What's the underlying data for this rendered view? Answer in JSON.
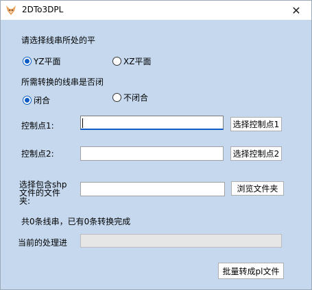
{
  "window": {
    "title": "2DTo3DPL",
    "close_glyph": "✕"
  },
  "plane": {
    "prompt": "请选择线串所处的平",
    "options": [
      {
        "label": "YZ平面",
        "checked": true
      },
      {
        "label": "XZ平面",
        "checked": false
      }
    ]
  },
  "closed": {
    "prompt": "所需转换的线串是否闭",
    "options": [
      {
        "label": "闭合",
        "checked": true
      },
      {
        "label": "不闭合",
        "checked": false
      }
    ]
  },
  "control1": {
    "label": "控制点1:",
    "value": "",
    "button": "选择控制点1"
  },
  "control2": {
    "label": "控制点2:",
    "value": "",
    "button": "选择控制点2"
  },
  "folder": {
    "label": "选择包含shp文件的文件夹:",
    "value": "",
    "button": "浏览文件夹"
  },
  "status": {
    "text": "共0条线串，已有0条转换完成"
  },
  "progress": {
    "label": "当前的处理进",
    "fraction": 0
  },
  "action": {
    "label": "批量转成pl文件"
  },
  "icons": {
    "app": "fox-app-icon",
    "close": "close-icon"
  },
  "colors": {
    "background": "#c5d8ee",
    "accent": "#0a5bc4"
  }
}
